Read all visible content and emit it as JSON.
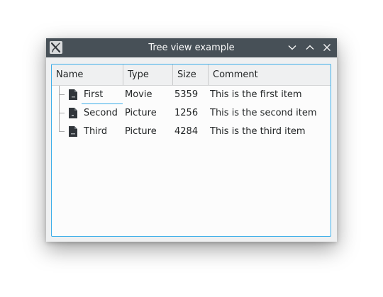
{
  "window": {
    "title": "Tree view example",
    "app_icon": "x-app-icon",
    "controls": [
      "minimize-icon",
      "maximize-icon",
      "close-icon"
    ]
  },
  "tree": {
    "columns": [
      "Name",
      "Type",
      "Size",
      "Comment"
    ],
    "rows": [
      {
        "name": "First",
        "type": "Movie",
        "size": "5359",
        "comment": "This is the first item",
        "icon": "file-icon"
      },
      {
        "name": "Second",
        "type": "Picture",
        "size": "1256",
        "comment": "This is the second item",
        "icon": "file-icon"
      },
      {
        "name": "Third",
        "type": "Picture",
        "size": "4284",
        "comment": "This is the third item",
        "icon": "file-icon"
      }
    ]
  },
  "colors": {
    "titlebar": "#475057",
    "accent": "#3daee9",
    "text": "#232627"
  }
}
